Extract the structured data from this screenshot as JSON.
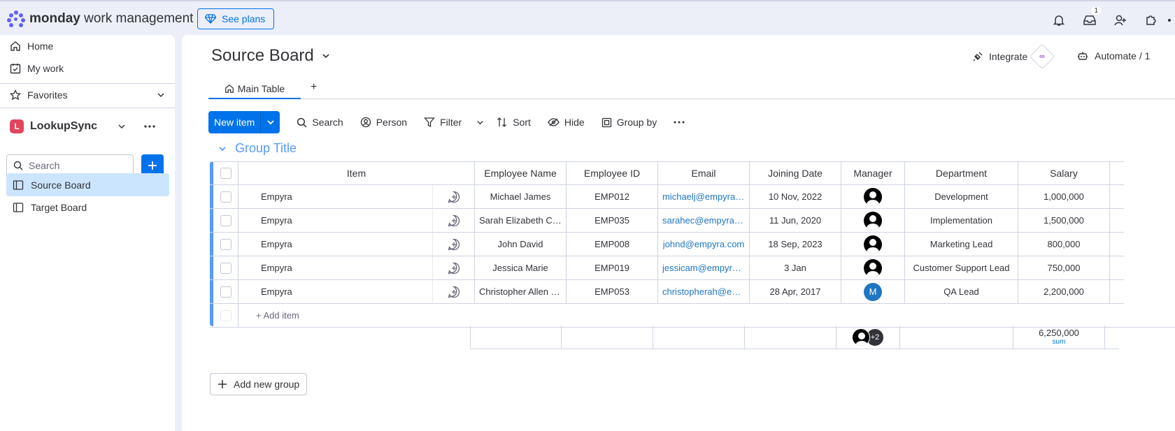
{
  "topbar": {
    "logo_brand": "monday",
    "logo_product": " work management",
    "see_plans": "See plans",
    "inbox_badge": "1"
  },
  "sidebar": {
    "home": "Home",
    "my_work": "My work",
    "favorites": "Favorites",
    "workspace_initial": "L",
    "workspace_name": "LookupSync",
    "search_placeholder": "Search",
    "boards": [
      {
        "label": "Source Board",
        "active": true
      },
      {
        "label": "Target Board",
        "active": false
      }
    ]
  },
  "board": {
    "title": "Source Board",
    "integrate": "Integrate",
    "automate": "Automate / 1",
    "tab_main": "Main Table",
    "tab_add": "+"
  },
  "toolbar": {
    "new_item": "New item",
    "search": "Search",
    "person": "Person",
    "filter": "Filter",
    "sort": "Sort",
    "hide": "Hide",
    "group_by": "Group by"
  },
  "group": {
    "title": "Group Title",
    "color": "#579bfc"
  },
  "table": {
    "headers": {
      "item": "Item",
      "name": "Employee Name",
      "eid": "Employee ID",
      "email": "Email",
      "jdate": "Joining Date",
      "mgr": "Manager",
      "dept": "Department",
      "sal": "Salary"
    },
    "rows": [
      {
        "item": "Empyra",
        "name": "Michael James",
        "eid": "EMP012",
        "email": "michaelj@empyra.c...",
        "jdate": "10 Nov, 2022",
        "mgr": "blank",
        "dept": "Development",
        "sal": "1,000,000"
      },
      {
        "item": "Empyra",
        "name": "Sarah Elizabeth Car...",
        "eid": "EMP035",
        "email": "sarahec@empyra.c...",
        "jdate": "11 Jun, 2020",
        "mgr": "blank",
        "dept": "Implementation",
        "sal": "1,500,000"
      },
      {
        "item": "Empyra",
        "name": "John David",
        "eid": "EMP008",
        "email": "johnd@empyra.com",
        "jdate": "18 Sep, 2023",
        "mgr": "blank",
        "dept": "Marketing Lead",
        "sal": "800,000"
      },
      {
        "item": "Empyra",
        "name": "Jessica Marie",
        "eid": "EMP019",
        "email": "jessicam@empyra....",
        "jdate": "3 Jan",
        "mgr": "blank",
        "dept": "Customer Support Lead",
        "sal": "750,000"
      },
      {
        "item": "Empyra",
        "name": "Christopher Allen H...",
        "eid": "EMP053",
        "email": "christopherah@em...",
        "jdate": "28 Apr, 2017",
        "mgr": "M",
        "dept": "QA Lead",
        "sal": "2,200,000"
      }
    ],
    "add_item": "+ Add item",
    "summary": {
      "mgr_extra": "+2",
      "salary_total": "6,250,000",
      "salary_label": "sum"
    }
  },
  "add_group": "Add new group"
}
